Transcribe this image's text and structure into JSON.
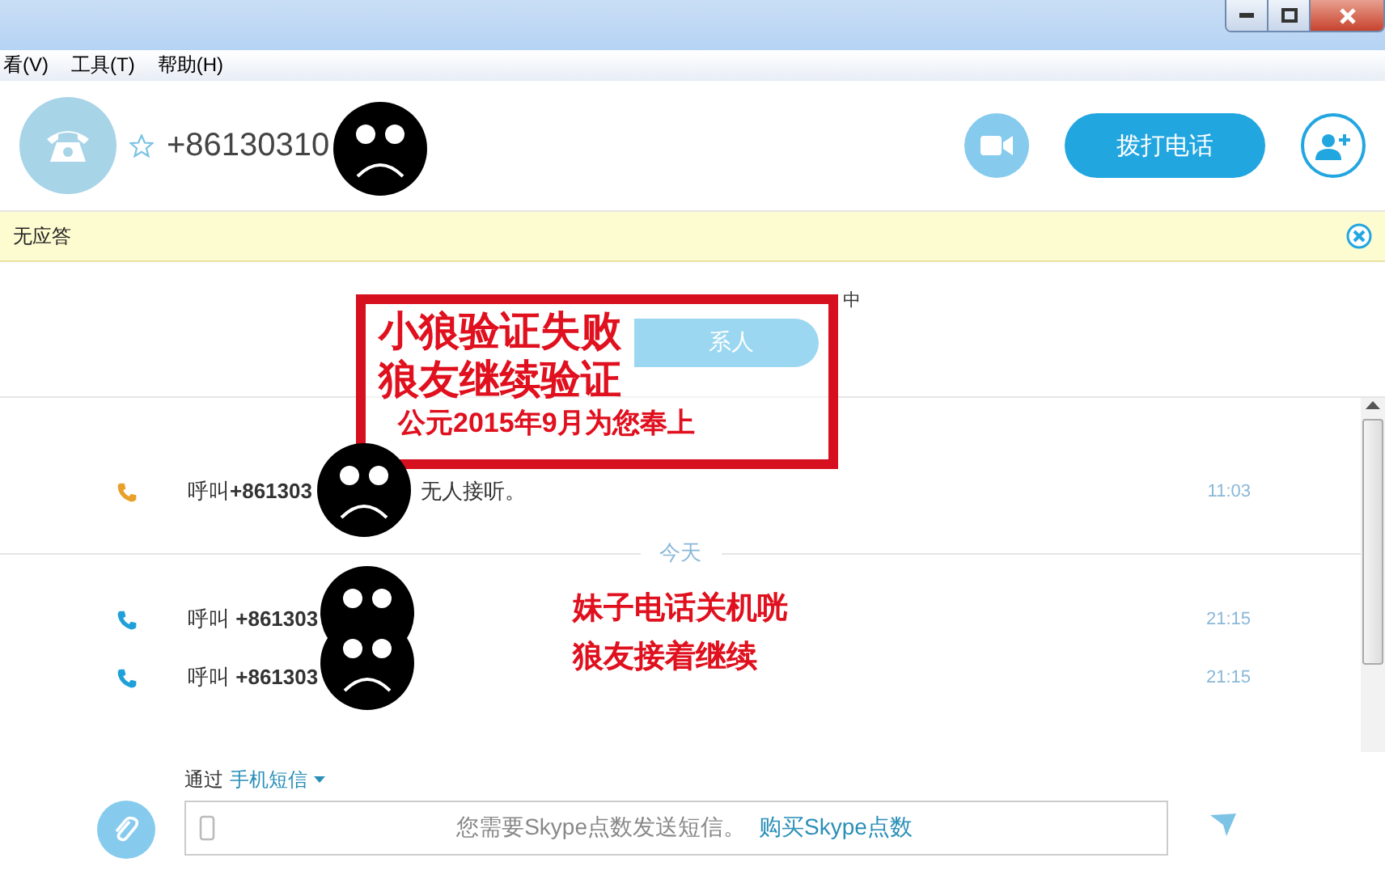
{
  "menu": [
    "看(V)",
    "工具(T)",
    "帮助(H)"
  ],
  "contact": {
    "name": "+86130310",
    "starred": false,
    "call_button": "拨打电话"
  },
  "notice": {
    "text": "无应答"
  },
  "request": {
    "status_text": "中",
    "button": "系人"
  },
  "history": [
    {
      "kind": "call",
      "missed": true,
      "text": "呼叫**+861303**",
      "detail": "无人接听。",
      "time": "11:03"
    },
    {
      "kind": "day",
      "text": "今天"
    },
    {
      "kind": "call",
      "missed": false,
      "text": "呼叫 **+861303**",
      "time": "21:15"
    },
    {
      "kind": "call",
      "missed": false,
      "text": "呼叫 **+861303**",
      "time": "21:15"
    }
  ],
  "compose": {
    "via_label": "通过",
    "via_value": "手机短信",
    "message": "您需要Skype点数发送短信。",
    "link": "购买Skype点数"
  },
  "stamp": {
    "lines": [
      "小狼验证失败",
      "狼友继续验证",
      "公元2015年9月为您奉上"
    ]
  },
  "annotation": {
    "lines": [
      "妹子电话关机咣",
      "狼友接着继续"
    ]
  }
}
